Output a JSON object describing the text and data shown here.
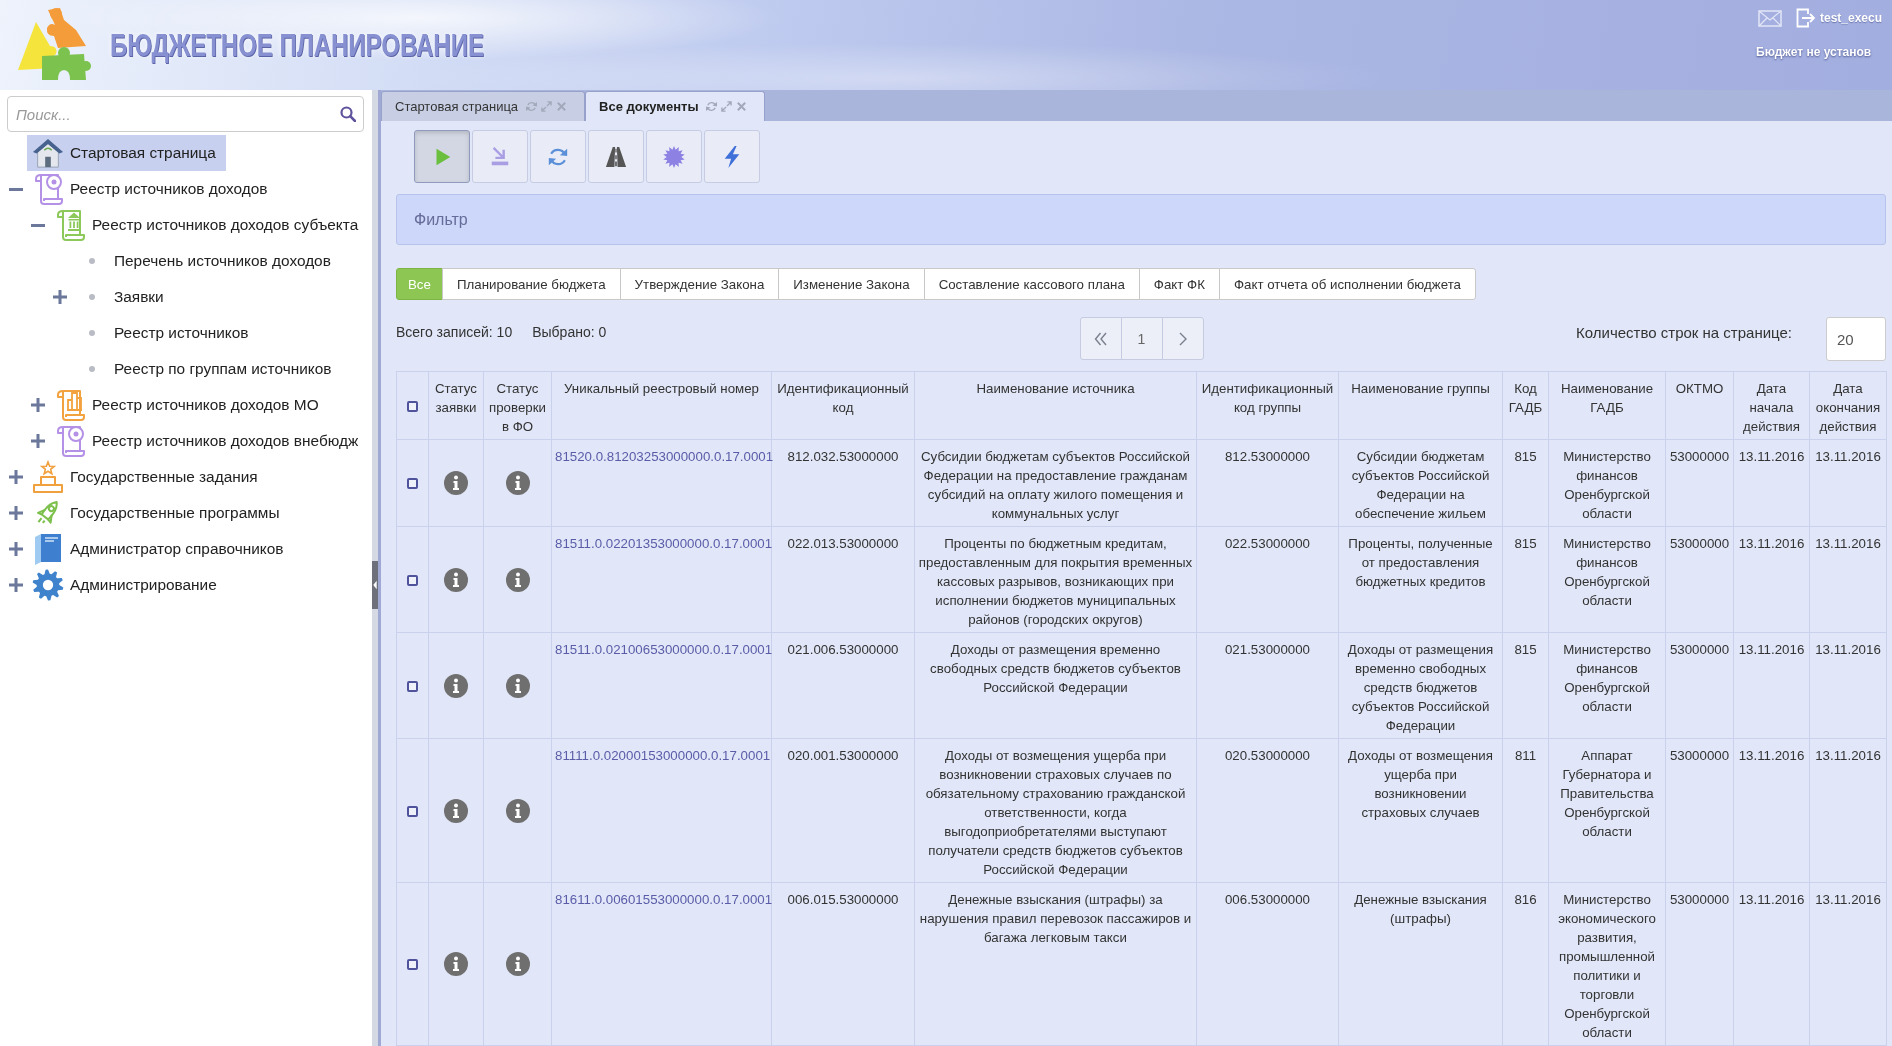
{
  "header": {
    "title": "БЮДЖЕТНОЕ ПЛАНИРОВАНИЕ",
    "user": "test_execu",
    "budget_status": "Бюджет не установ"
  },
  "sidebar": {
    "search": {
      "placeholder": "Поиск..."
    },
    "tree": [
      {
        "label": "Стартовая страница",
        "kind": "page",
        "selected": true
      },
      {
        "label": "Реестр источников доходов",
        "kind": "group",
        "expanded": true,
        "selected": false,
        "children": [
          {
            "label": "Реестр источников доходов субъекта",
            "kind": "group",
            "expanded": true,
            "selected": false,
            "children": [
              {
                "label": "Перечень источников доходов",
                "kind": "page",
                "selected": false
              },
              {
                "label": "Заявки",
                "kind": "group",
                "expanded": false,
                "selected": false
              },
              {
                "label": "Реестр источников",
                "kind": "page",
                "selected": false
              },
              {
                "label": "Реестр по группам источников",
                "kind": "page",
                "selected": false
              }
            ]
          },
          {
            "label": "Реестр источников доходов МО",
            "kind": "group",
            "expanded": false,
            "selected": false
          },
          {
            "label": "Реестр источников доходов внебюдж",
            "kind": "group",
            "expanded": false,
            "selected": false
          }
        ]
      },
      {
        "label": "Государственные задания",
        "kind": "group",
        "expanded": false,
        "selected": false
      },
      {
        "label": "Государственные программы",
        "kind": "group",
        "expanded": false,
        "selected": false
      },
      {
        "label": "Администратор справочников",
        "kind": "group",
        "expanded": false,
        "selected": false
      },
      {
        "label": "Администрирование",
        "kind": "group",
        "expanded": false,
        "selected": false
      }
    ]
  },
  "tabs": [
    {
      "label": "Стартовая страница",
      "selected": false
    },
    {
      "label": "Все документы",
      "selected": true
    }
  ],
  "toolbar": [
    {
      "pressed": true
    },
    {
      "pressed": false
    },
    {
      "pressed": false
    },
    {
      "pressed": false
    },
    {
      "pressed": false
    },
    {
      "pressed": false
    }
  ],
  "filter": {
    "title": "Фильтр"
  },
  "stages": [
    {
      "label": "Все",
      "selected": true
    },
    {
      "label": "Планирование бюджета",
      "selected": false
    },
    {
      "label": "Утверждение Закона",
      "selected": false
    },
    {
      "label": "Изменение Закона",
      "selected": false
    },
    {
      "label": "Составление кассового плана",
      "selected": false
    },
    {
      "label": "Факт ФК",
      "selected": false
    },
    {
      "label": "Факт отчета об исполнении бюджета",
      "selected": false
    }
  ],
  "summary": {
    "total": "Всего записей: 10",
    "selected": "Выбрано: 0"
  },
  "pagination": {
    "page": "1"
  },
  "rows_per_page": {
    "label": "Количество строк на странице:",
    "value": "20"
  },
  "table": {
    "select_all": {
      "checked": false
    },
    "columns": [
      "Статус заявки",
      "Статус проверки в ФО",
      "Уникальный реестровый номер",
      "Идентификационный код",
      "Наименование источника",
      "Идентификационный код группы",
      "Наименование группы",
      "Код ГАДБ",
      "Наименование ГАДБ",
      "ОКТМО",
      "Дата начала действия",
      "Дата окончания действия"
    ],
    "rows": [
      {
        "checked": false,
        "number": "81520.0.81203253000000.0.17.0001",
        "id_code": "812.032.53000000",
        "source_name": "Субсидии бюджетам субъектов Российской Федерации на предоставление гражданам субсидий на оплату жилого помещения и коммунальных услуг",
        "group_code": "812.53000000",
        "group_name": "Субсидии бюджетам субъектов Российской Федерации на обеспечение жильем",
        "gadb_code": "815",
        "gadb_name": "Министерство финансов Оренбургской области",
        "oktmo": "53000000",
        "start_date": "13.11.2016",
        "end_date": "13.11.2016"
      },
      {
        "checked": false,
        "number": "81511.0.02201353000000.0.17.0001",
        "id_code": "022.013.53000000",
        "source_name": "Проценты по бюджетным кредитам, предоставленным для покрытия временных кассовых разрывов, возникающих при исполнении бюджетов муниципальных районов (городских округов)",
        "group_code": "022.53000000",
        "group_name": "Проценты, полученные от предоставления бюджетных кредитов",
        "gadb_code": "815",
        "gadb_name": "Министерство финансов Оренбургской области",
        "oktmo": "53000000",
        "start_date": "13.11.2016",
        "end_date": "13.11.2016"
      },
      {
        "checked": false,
        "number": "81511.0.02100653000000.0.17.0001",
        "id_code": "021.006.53000000",
        "source_name": "Доходы от размещения временно свободных средств бюджетов субъектов Российской Федерации",
        "group_code": "021.53000000",
        "group_name": "Доходы от размещения временно свободных средств бюджетов субъектов Российской Федерации",
        "gadb_code": "815",
        "gadb_name": "Министерство финансов Оренбургской области",
        "oktmo": "53000000",
        "start_date": "13.11.2016",
        "end_date": "13.11.2016"
      },
      {
        "checked": false,
        "number": "81111.0.02000153000000.0.17.0001",
        "id_code": "020.001.53000000",
        "source_name": "Доходы от возмещения ущерба при возникновении страховых случаев по обязательному страхованию гражданской ответственности, когда выгодоприобретателями выступают получатели средств бюджетов субъектов Российской Федерации",
        "group_code": "020.53000000",
        "group_name": "Доходы от возмещения ущерба при возникновении страховых случаев",
        "gadb_code": "811",
        "gadb_name": "Аппарат Губернатора и Правительства Оренбургской области",
        "oktmo": "53000000",
        "start_date": "13.11.2016",
        "end_date": "13.11.2016"
      },
      {
        "checked": false,
        "number": "81611.0.00601553000000.0.17.0001",
        "id_code": "006.015.53000000",
        "source_name": "Денежные взыскания (штрафы) за нарушения правил перевозок пассажиров и багажа легковым такси",
        "group_code": "006.53000000",
        "group_name": "Денежные взыскания (штрафы)",
        "gadb_code": "816",
        "gadb_name": "Министерство экономического развития, промышленной политики и торговли Оренбургской области",
        "oktmo": "53000000",
        "start_date": "13.11.2016",
        "end_date": "13.11.2016"
      }
    ]
  }
}
